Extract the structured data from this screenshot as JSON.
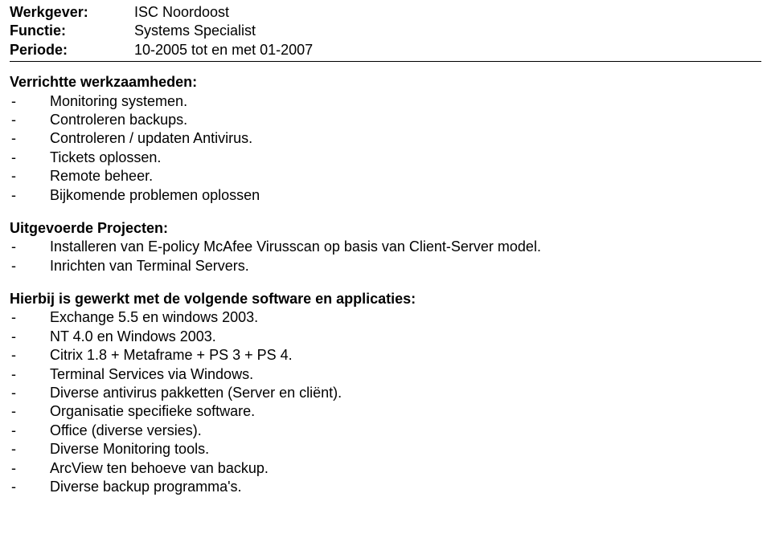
{
  "header": {
    "labels": {
      "employer": "Werkgever:",
      "role": "Functie:",
      "period": "Periode:"
    },
    "values": {
      "employer": "ISC Noordoost",
      "role": "Systems Specialist",
      "period": "10-2005 tot en met 01-2007"
    }
  },
  "sections": {
    "duties": {
      "title": "Verrichtte werkzaamheden:",
      "items": [
        "Monitoring systemen.",
        "Controleren backups.",
        "Controleren / updaten Antivirus.",
        "Tickets oplossen.",
        "Remote beheer.",
        "Bijkomende problemen oplossen"
      ]
    },
    "projects": {
      "title": "Uitgevoerde Projecten:",
      "items": [
        "Installeren van E-policy McAfee Virusscan op basis van Client-Server model.",
        "Inrichten van Terminal Servers."
      ]
    },
    "software": {
      "title": "Hierbij is gewerkt met de volgende software en applicaties:",
      "items": [
        "Exchange 5.5 en windows 2003.",
        "NT 4.0 en Windows 2003.",
        "Citrix 1.8 + Metaframe + PS 3 + PS 4.",
        "Terminal Services via Windows.",
        "Diverse antivirus pakketten (Server en cliënt).",
        "Organisatie specifieke software.",
        "Office (diverse versies).",
        "Diverse Monitoring tools.",
        "ArcView ten behoeve van backup.",
        "Diverse backup programma's."
      ]
    }
  },
  "bullet": "-"
}
